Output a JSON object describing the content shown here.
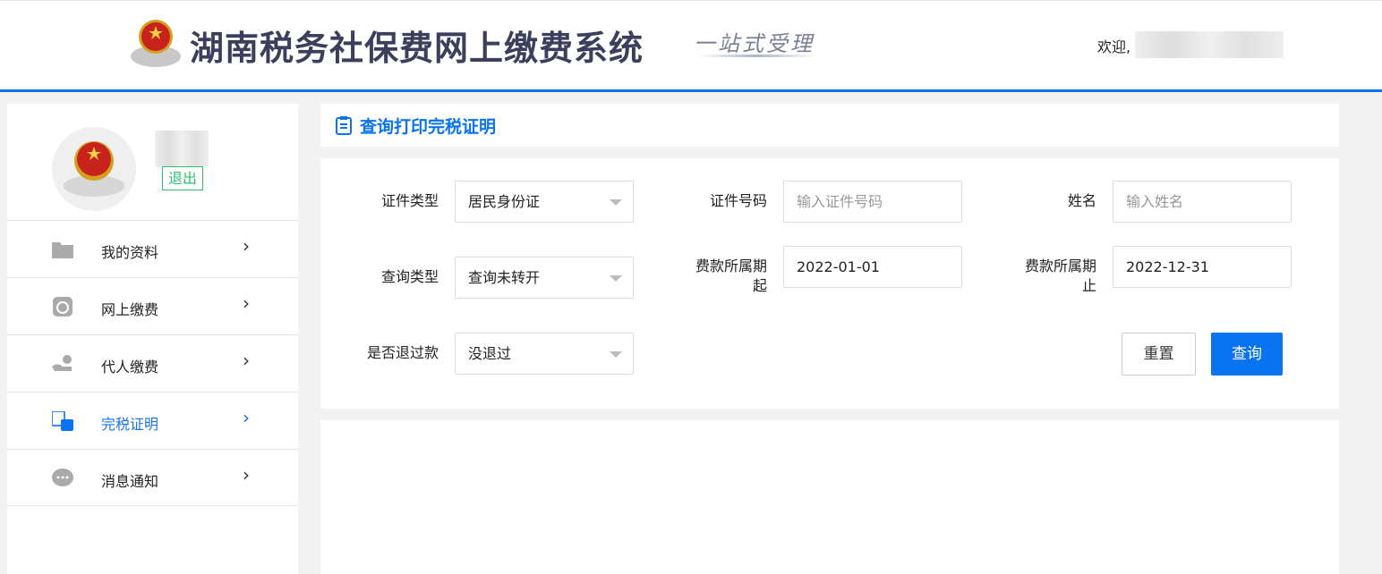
{
  "header": {
    "title": "湖南税务社保费网上缴费系统",
    "slogan": "一站式受理",
    "welcome": "欢迎,"
  },
  "sidebar": {
    "logout": "退出",
    "items": [
      {
        "label": "我的资料",
        "icon": "folder-icon"
      },
      {
        "label": "网上缴费",
        "icon": "payment-icon"
      },
      {
        "label": "代人缴费",
        "icon": "hand-coin-icon"
      },
      {
        "label": "完税证明",
        "icon": "certificate-icon",
        "active": true
      },
      {
        "label": "消息通知",
        "icon": "message-icon"
      }
    ]
  },
  "page": {
    "title": "查询打印完税证明"
  },
  "form": {
    "id_type": {
      "label": "证件类型",
      "value": "居民身份证"
    },
    "id_number": {
      "label": "证件号码",
      "placeholder": "输入证件号码"
    },
    "name": {
      "label": "姓名",
      "placeholder": "输入姓名"
    },
    "query_type": {
      "label": "查询类型",
      "value": "查询未转开"
    },
    "period_start": {
      "label_1": "费款所属期",
      "label_2": "起",
      "value": "2022-01-01"
    },
    "period_end": {
      "label_1": "费款所属期",
      "label_2": "止",
      "value": "2022-12-31"
    },
    "refunded": {
      "label": "是否退过款",
      "value": "没退过"
    },
    "reset_label": "重置",
    "query_label": "查询"
  },
  "colors": {
    "accent": "#0a73f0",
    "logout": "#2fbf71"
  }
}
